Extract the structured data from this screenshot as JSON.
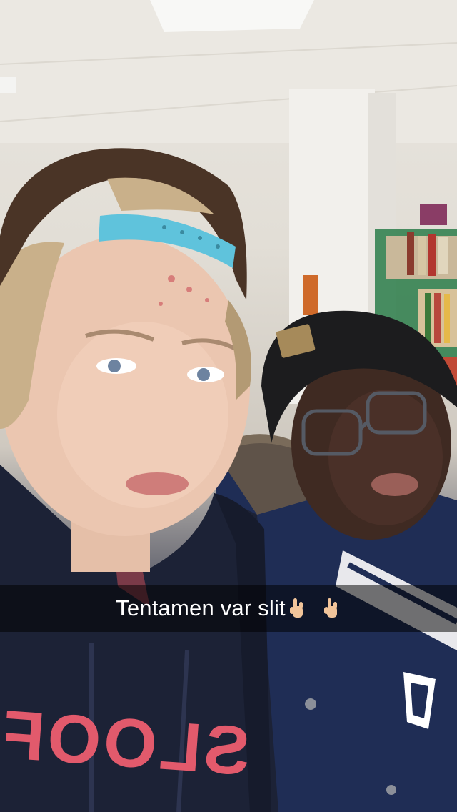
{
  "snap": {
    "caption": "Tentamen var slit",
    "caption_emojis": [
      "hand-sign-icon",
      "hand-sign-icon"
    ],
    "hoodie_text": "SLOOF",
    "colors": {
      "caption_bar": "#000000",
      "caption_text": "#ffffff",
      "hoodie": "#1c2236",
      "cap": "#4a3426",
      "cap_strap": "#5fc3dc",
      "beanie": "#1c1c1e",
      "jacket": "#1f2d55"
    }
  }
}
